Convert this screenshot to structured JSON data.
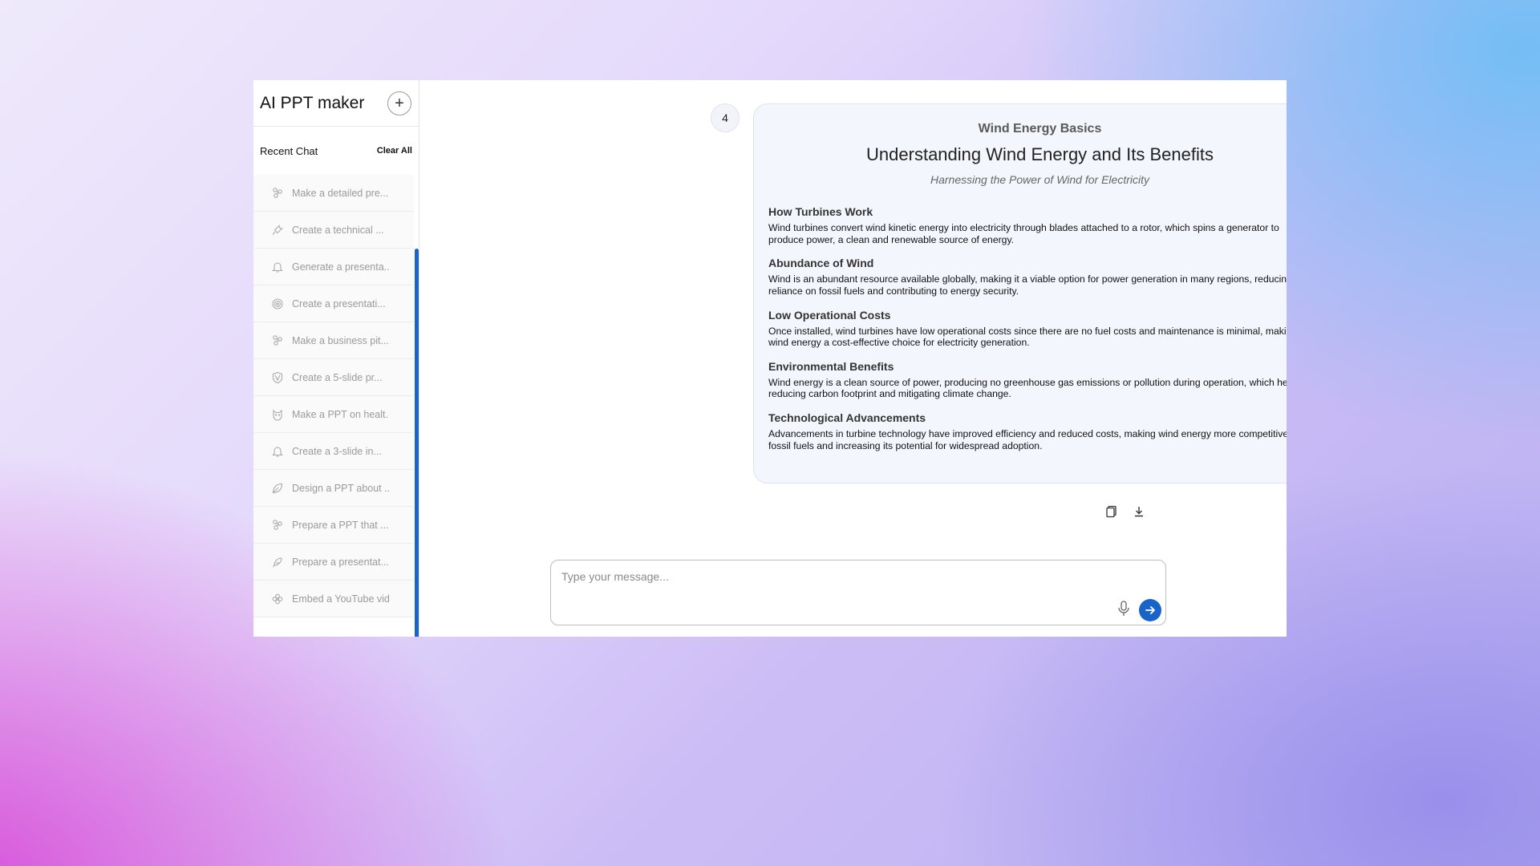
{
  "sidebar": {
    "title": "AI PPT maker",
    "new_chat_icon": "plus-icon",
    "recent_label": "Recent Chat",
    "clear_all": "Clear All",
    "items": [
      {
        "label": "Make a detailed pre...",
        "icon": "cluster-icon"
      },
      {
        "label": "Create a technical ...",
        "icon": "wrench-icon"
      },
      {
        "label": "Generate a presenta..",
        "icon": "bell-icon"
      },
      {
        "label": "Create a presentati...",
        "icon": "spiral-icon"
      },
      {
        "label": "Make a business pit...",
        "icon": "cluster-icon"
      },
      {
        "label": "Create a 5-slide pr...",
        "icon": "shield-icon"
      },
      {
        "label": "Make a PPT on healt.",
        "icon": "cat-icon"
      },
      {
        "label": "Create a 3-slide in...",
        "icon": "bell-icon"
      },
      {
        "label": "Design a PPT about ..",
        "icon": "leaf-icon"
      },
      {
        "label": "Prepare a PPT that ...",
        "icon": "cluster-icon"
      },
      {
        "label": "Prepare a presentat...",
        "icon": "feather-icon"
      },
      {
        "label": "Embed a YouTube vid",
        "icon": "flower-icon"
      }
    ]
  },
  "main": {
    "message_number": "4",
    "slide": {
      "topic": "Wind Energy Basics",
      "title": "Understanding Wind Energy and Its Benefits",
      "subtitle": "Harnessing the Power of Wind for Electricity",
      "sections": [
        {
          "heading": "How Turbines Work",
          "body": "Wind turbines convert wind kinetic energy into electricity through blades attached to a rotor, which spins a generator to produce power, a clean and renewable source of energy."
        },
        {
          "heading": "Abundance of Wind",
          "body": "Wind is an abundant resource available globally, making it a viable option for power generation in many regions, reducing reliance on fossil fuels and contributing to energy security."
        },
        {
          "heading": "Low Operational Costs",
          "body": "Once installed, wind turbines have low operational costs since there are no fuel costs and maintenance is minimal, making wind energy a cost-effective choice for electricity generation."
        },
        {
          "heading": "Environmental Benefits",
          "body": "Wind energy is a clean source of power, producing no greenhouse gas emissions or pollution during operation, which helps in reducing carbon footprint and mitigating climate change."
        },
        {
          "heading": "Technological Advancements",
          "body": "Advancements in turbine technology have improved efficiency and reduced costs, making wind energy more competitive with fossil fuels and increasing its potential for widespread adoption."
        }
      ]
    },
    "actions": {
      "copy_icon": "copy-icon",
      "download_icon": "download-icon"
    },
    "input": {
      "placeholder": "Type your message...",
      "mic_icon": "mic-icon",
      "send_icon": "send-arrow-icon"
    },
    "toggle": {
      "state": "off"
    }
  },
  "colors": {
    "accent": "#1a64c8"
  }
}
